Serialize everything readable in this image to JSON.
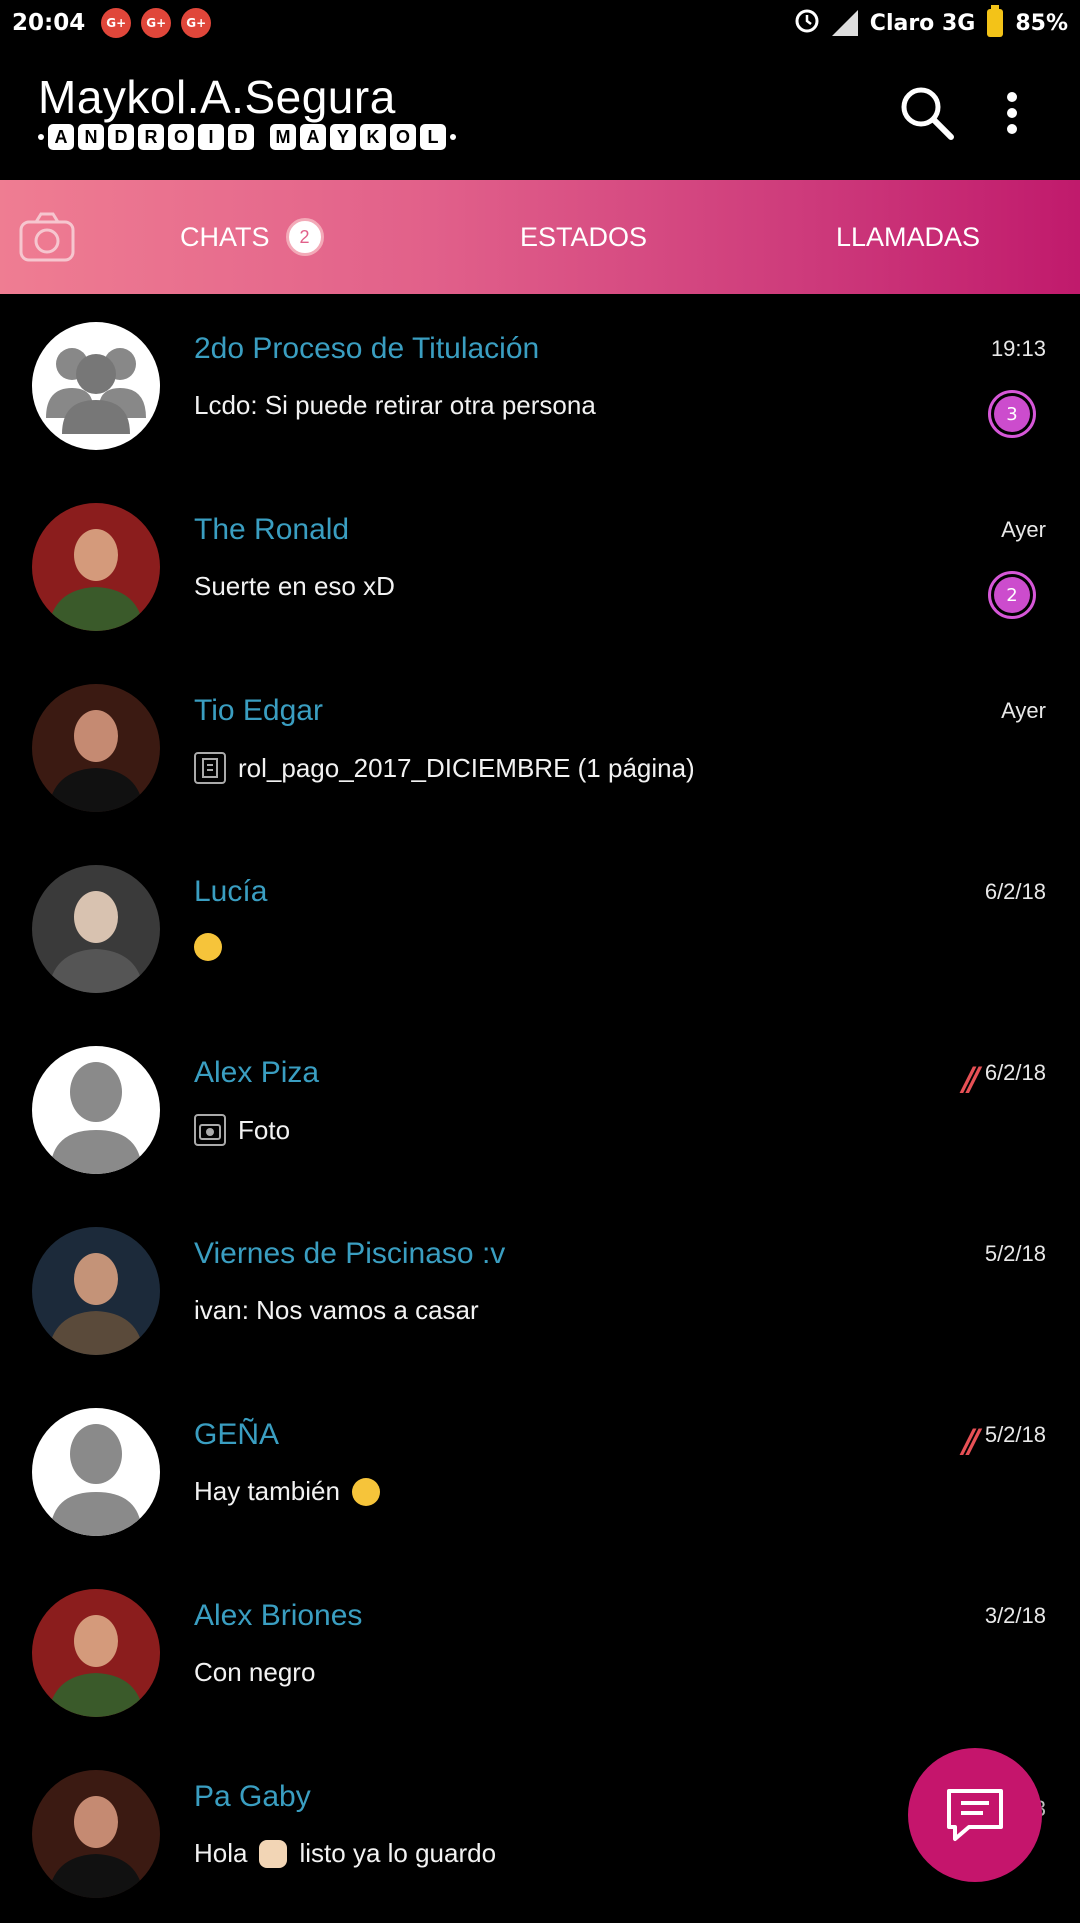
{
  "status_bar": {
    "time": "20:04",
    "notif_label": "G+",
    "carrier": "Claro 3G",
    "battery": "85%"
  },
  "header": {
    "title": "Maykol.A.Segura",
    "subtitle_word1": [
      "A",
      "N",
      "D",
      "R",
      "O",
      "I",
      "D"
    ],
    "subtitle_word2": [
      "M",
      "A",
      "Y",
      "K",
      "O",
      "L"
    ]
  },
  "tabs": {
    "chats": "CHATS",
    "chats_badge": "2",
    "estados": "ESTADOS",
    "llamadas": "LLAMADAS"
  },
  "chats": [
    {
      "name": "2do Proceso de Titulación",
      "time": "19:13",
      "message": "Lcdo: Si puede  retirar otra persona",
      "unread": "3",
      "avatar": "group-placeholder"
    },
    {
      "name": "The Ronald",
      "time": "Ayer",
      "message": "Suerte en eso xD",
      "unread": "2",
      "avatar": "photo"
    },
    {
      "name": "Tio Edgar",
      "time": "Ayer",
      "message": "rol_pago_2017_DICIEMBRE (1 página)",
      "avatar": "photo",
      "msg_icon": "document-icon"
    },
    {
      "name": "Lucía",
      "time": "6/2/18",
      "message": "",
      "avatar": "photo",
      "msg_icon": "emoji-hug"
    },
    {
      "name": "Alex Piza",
      "time": "6/2/18",
      "message": "Foto",
      "avatar": "person-placeholder",
      "msg_icon": "camera-icon",
      "marker": "//"
    },
    {
      "name": "Viernes de Piscinaso :v",
      "time": "5/2/18",
      "message": "ivan: Nos vamos a casar",
      "avatar": "photo"
    },
    {
      "name": "GEÑA",
      "time": "5/2/18",
      "message": "Hay también",
      "avatar": "person-placeholder",
      "marker": "//",
      "trailing_emoji": "emoji-grin"
    },
    {
      "name": "Alex Briones",
      "time": "3/2/18",
      "message": "Con negro",
      "avatar": "photo"
    },
    {
      "name": "Pa Gaby",
      "time": "3",
      "message": "listo ya lo guardo",
      "msg_prefix": "Hola",
      "avatar": "photo",
      "msg_icon": "emoji-hand"
    }
  ],
  "colors": {
    "name": "#3a9ec1",
    "accent": "#c5156c",
    "unread": "#cc4ccd",
    "tab_gradient_start": "#ef7d92",
    "tab_gradient_end": "#c01a6c"
  }
}
